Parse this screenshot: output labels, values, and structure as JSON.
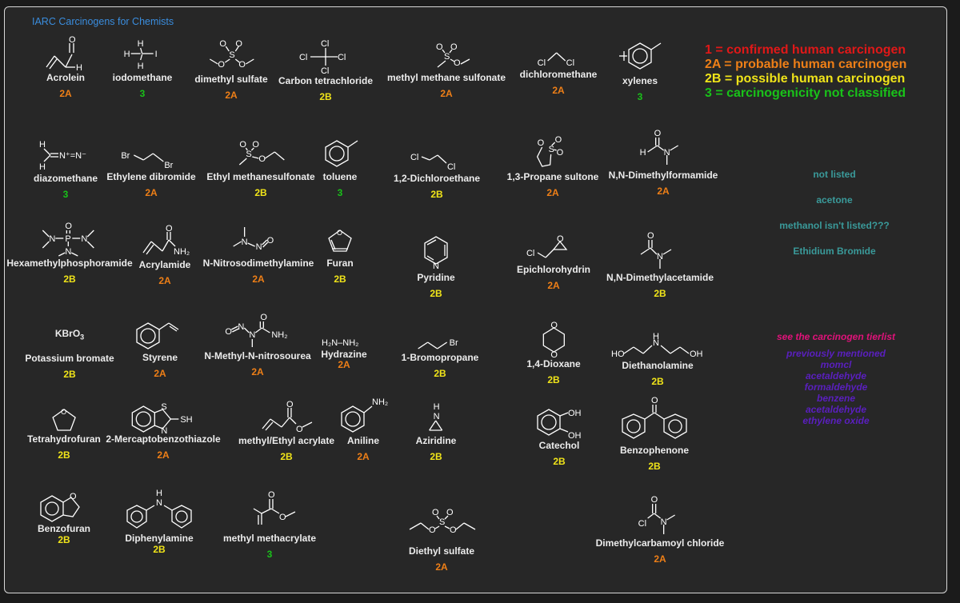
{
  "title": "IARC Carcinogens for Chemists",
  "legend": [
    {
      "code": "1",
      "text": "1 = confirmed human carcinogen",
      "color": "#e01818"
    },
    {
      "code": "2A",
      "text": "2A = probable human carcinogen",
      "color": "#ee7f17"
    },
    {
      "code": "2B",
      "text": "2B = possible human carcinogen",
      "color": "#f0e419"
    },
    {
      "code": "3",
      "text": "3 = carcinogenicity not classified",
      "color": "#19c219"
    }
  ],
  "compounds": [
    {
      "id": "acrolein",
      "name": "Acrolein",
      "class": "2A"
    },
    {
      "id": "iodomethane",
      "name": "iodomethane",
      "class": "3"
    },
    {
      "id": "dimethyl-sulfate",
      "name": "dimethyl sulfate",
      "class": "2A"
    },
    {
      "id": "carbon-tetrachloride",
      "name": "Carbon tetrachloride",
      "class": "2B"
    },
    {
      "id": "methyl-methane-sulfonate",
      "name": "methyl methane sulfonate",
      "class": "2A"
    },
    {
      "id": "dichloromethane",
      "name": "dichloromethane",
      "class": "2A"
    },
    {
      "id": "xylenes",
      "name": "xylenes",
      "class": "3"
    },
    {
      "id": "diazomethane",
      "name": "diazomethane",
      "class": "3"
    },
    {
      "id": "ethylene-dibromide",
      "name": "Ethylene dibromide",
      "class": "2A"
    },
    {
      "id": "ethyl-methanesulfonate",
      "name": "Ethyl methanesulfonate",
      "class": "2B"
    },
    {
      "id": "toluene",
      "name": "toluene",
      "class": "3"
    },
    {
      "id": "dichloroethane",
      "name": "1,2-Dichloroethane",
      "class": "2B"
    },
    {
      "id": "propane-sultone",
      "name": "1,3-Propane sultone",
      "class": "2A"
    },
    {
      "id": "dmf",
      "name": "N,N-Dimethylformamide",
      "class": "2A"
    },
    {
      "id": "hmpa",
      "name": "Hexamethylphosphoramide",
      "class": "2B"
    },
    {
      "id": "acrylamide",
      "name": "Acrylamide",
      "class": "2A"
    },
    {
      "id": "nitrosodimethylamine",
      "name": "N-Nitrosodimethylamine",
      "class": "2A"
    },
    {
      "id": "furan",
      "name": "Furan",
      "class": "2B"
    },
    {
      "id": "pyridine",
      "name": "Pyridine",
      "class": "2B"
    },
    {
      "id": "epichlorohydrin",
      "name": "Epichlorohydrin",
      "class": "2A"
    },
    {
      "id": "dma",
      "name": "N,N-Dimethylacetamide",
      "class": "2B"
    },
    {
      "id": "kbro3",
      "name": "Potassium bromate",
      "class": "2B",
      "formula": "KBrO3"
    },
    {
      "id": "styrene",
      "name": "Styrene",
      "class": "2A"
    },
    {
      "id": "methyl-nitrosourea",
      "name": "N-Methyl-N-nitrosourea",
      "class": "2A"
    },
    {
      "id": "hydrazine",
      "name": "Hydrazine",
      "class": "2A"
    },
    {
      "id": "bromopropane",
      "name": "1-Bromopropane",
      "class": "2B"
    },
    {
      "id": "dioxane",
      "name": "1,4-Dioxane",
      "class": "2B"
    },
    {
      "id": "diethanolamine",
      "name": "Diethanolamine",
      "class": "2B"
    },
    {
      "id": "thf",
      "name": "Tetrahydrofuran",
      "class": "2B"
    },
    {
      "id": "mercaptobenzothiazole",
      "name": "2-Mercaptobenzothiazole",
      "class": "2A"
    },
    {
      "id": "acrylate",
      "name": "methyl/Ethyl acrylate",
      "class": "2B"
    },
    {
      "id": "aniline",
      "name": "Aniline",
      "class": "2A"
    },
    {
      "id": "aziridine",
      "name": "Aziridine",
      "class": "2B"
    },
    {
      "id": "catechol",
      "name": "Catechol",
      "class": "2B"
    },
    {
      "id": "benzophenone",
      "name": "Benzophenone",
      "class": "2B"
    },
    {
      "id": "benzofuran",
      "name": "Benzofuran",
      "class": "2B"
    },
    {
      "id": "diphenylamine",
      "name": "Diphenylamine",
      "class": "2B"
    },
    {
      "id": "methyl-methacrylate",
      "name": "methyl methacrylate",
      "class": "3"
    },
    {
      "id": "diethyl-sulfate",
      "name": "Diethyl sulfate",
      "class": "2A"
    },
    {
      "id": "dimethylcarbamoyl-chloride",
      "name": "Dimethylcarbamoyl chloride",
      "class": "2A"
    }
  ],
  "not_listed": [
    "not listed",
    "acetone",
    "methanol isn't listed???",
    "Ethidium Bromide"
  ],
  "tierlist": {
    "link": "see the carcinogen tierlist",
    "items": [
      "previously mentioned",
      "momcl",
      "acetaldehyde",
      "formaldehyde",
      "benzene",
      "acetaldehyde",
      "ethylene oxide"
    ]
  }
}
